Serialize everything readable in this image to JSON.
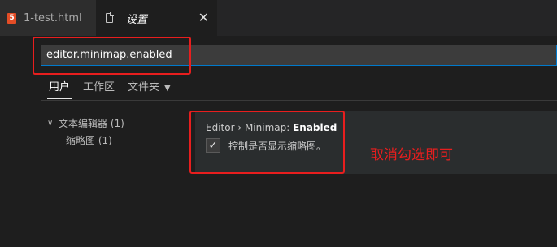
{
  "tabs": [
    {
      "label": "1-test.html",
      "icon": "html5-icon",
      "icon_glyph": "5"
    },
    {
      "label": "设置",
      "icon": "file-icon",
      "close": "✕"
    }
  ],
  "search": {
    "value": "editor.minimap.enabled"
  },
  "scopes": [
    {
      "label": "用户"
    },
    {
      "label": "工作区"
    },
    {
      "label": "文件夹"
    }
  ],
  "toc": {
    "group": "文本编辑器 (1)",
    "item": "缩略图 (1)"
  },
  "setting": {
    "category": "Editor › Minimap: ",
    "name": "Enabled",
    "checked": true,
    "description": "控制是否显示缩略图。"
  },
  "annotation": "取消勾选即可",
  "colors": {
    "highlight": "#e81e1e",
    "focus": "#007acc",
    "html_icon": "#e44d26"
  }
}
